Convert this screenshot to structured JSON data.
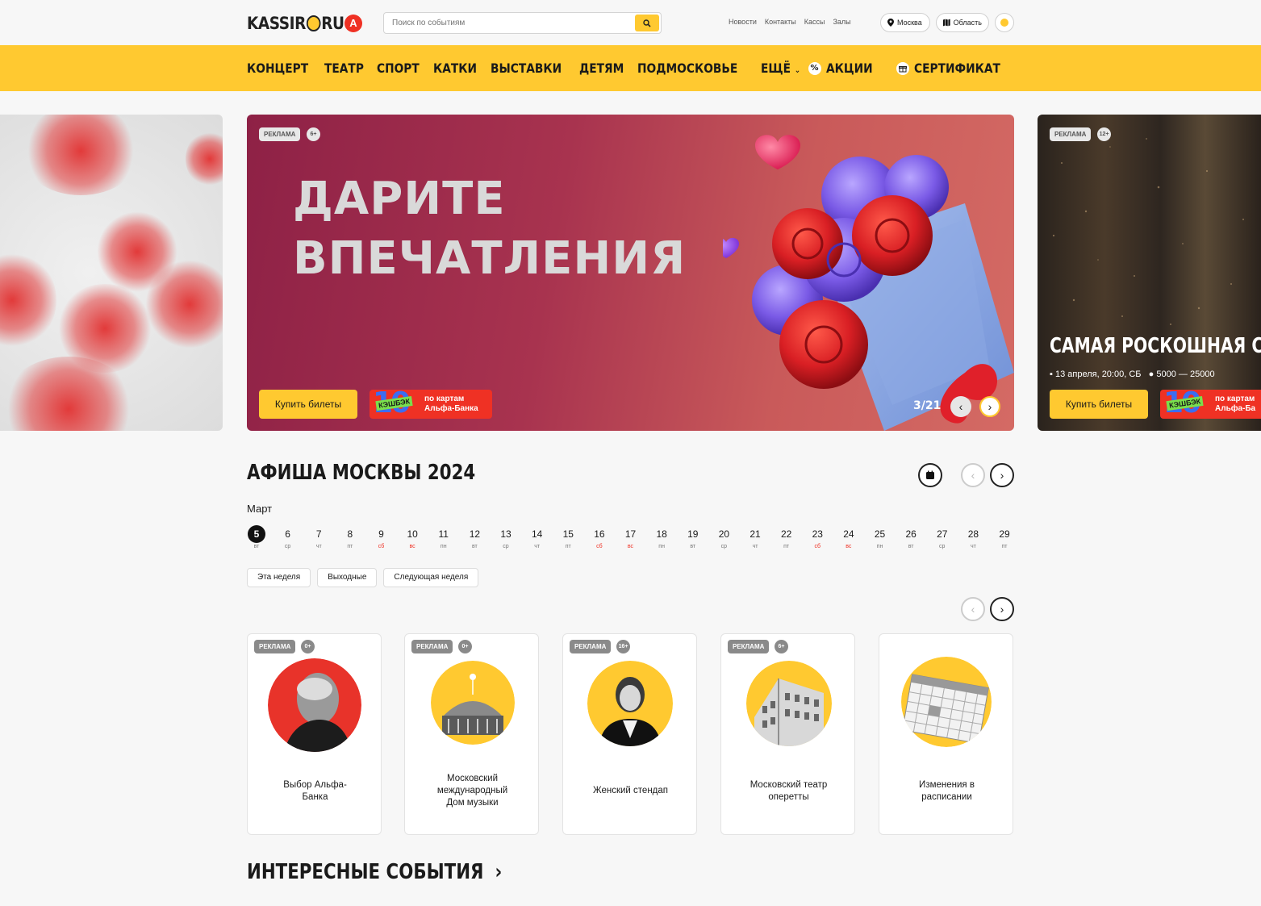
{
  "header": {
    "logo_text": "KASSIR",
    "logo_suffix": "RU",
    "logo_badge": "А",
    "search_placeholder": "Поиск по событиям",
    "links": [
      "Новости",
      "Контакты",
      "Кассы",
      "Залы"
    ],
    "city": "Москва",
    "region": "Область"
  },
  "nav": {
    "items": [
      "КОНЦЕРТ",
      "ТЕАТР",
      "СПОРТ",
      "КАТКИ",
      "ВЫСТАВКИ",
      "ДЕТЯМ",
      "ПОДМОСКОВЬЕ",
      "ЕЩЁ"
    ],
    "promo": "АКЦИИ",
    "certificate": "СЕРТИФИКАТ"
  },
  "banner_main": {
    "ad_label": "РЕКЛАМА",
    "age": "6+",
    "headline_line1": "ДАРИТЕ",
    "headline_line2": "ВПЕЧАТЛЕНИЯ",
    "buy_label": "Купить билеты",
    "cashback_percent": "10",
    "cashback_label": "КЭШБЭК",
    "cashback_text_line1": "по картам",
    "cashback_text_line2": "Альфа-Банка",
    "counter": "3/21"
  },
  "banner_right": {
    "ad_label": "РЕКЛАМА",
    "age": "12+",
    "title": "САМАЯ РОСКОШНАЯ СВА",
    "date": "13 апреля, 20:00, СБ",
    "price": "5000 — 25000",
    "buy_label": "Купить билеты",
    "cashback_percent": "10",
    "cashback_label": "КЭШБЭК",
    "cashback_text_line1": "по картам",
    "cashback_text_line2": "Альфа-Бa"
  },
  "afisha": {
    "title": "АФИША МОСКВЫ 2024",
    "month": "Март",
    "days": [
      {
        "num": "5",
        "wd": "вт",
        "active": true
      },
      {
        "num": "6",
        "wd": "ср"
      },
      {
        "num": "7",
        "wd": "чт"
      },
      {
        "num": "8",
        "wd": "пт"
      },
      {
        "num": "9",
        "wd": "сб",
        "weekend": true
      },
      {
        "num": "10",
        "wd": "вс",
        "weekend": true
      },
      {
        "num": "11",
        "wd": "пн"
      },
      {
        "num": "12",
        "wd": "вт"
      },
      {
        "num": "13",
        "wd": "ср"
      },
      {
        "num": "14",
        "wd": "чт"
      },
      {
        "num": "15",
        "wd": "пт"
      },
      {
        "num": "16",
        "wd": "сб",
        "weekend": true
      },
      {
        "num": "17",
        "wd": "вс",
        "weekend": true
      },
      {
        "num": "18",
        "wd": "пн"
      },
      {
        "num": "19",
        "wd": "вт"
      },
      {
        "num": "20",
        "wd": "ср"
      },
      {
        "num": "21",
        "wd": "чт"
      },
      {
        "num": "22",
        "wd": "пт"
      },
      {
        "num": "23",
        "wd": "сб",
        "weekend": true
      },
      {
        "num": "24",
        "wd": "вс",
        "weekend": true
      },
      {
        "num": "25",
        "wd": "пн"
      },
      {
        "num": "26",
        "wd": "вт"
      },
      {
        "num": "27",
        "wd": "ср"
      },
      {
        "num": "28",
        "wd": "чт"
      },
      {
        "num": "29",
        "wd": "пт"
      }
    ],
    "chips": [
      "Эта неделя",
      "Выходные",
      "Следующая неделя"
    ]
  },
  "cards": [
    {
      "ad": "РЕКЛАМА",
      "age": "0+",
      "label_line1": "Выбор Альфа-",
      "label_line2": "Банка",
      "label_line3": "",
      "color": "#e8332a"
    },
    {
      "ad": "РЕКЛАМА",
      "age": "0+",
      "label_line1": "Московский",
      "label_line2": "международный",
      "label_line3": "Дом музыки",
      "color": "#ffc930"
    },
    {
      "ad": "РЕКЛАМА",
      "age": "16+",
      "label_line1": "Женский стендап",
      "label_line2": "",
      "label_line3": "",
      "color": "#ffc930"
    },
    {
      "ad": "РЕКЛАМА",
      "age": "6+",
      "label_line1": "Московский театр",
      "label_line2": "оперетты",
      "label_line3": "",
      "color": "#ffc930"
    },
    {
      "ad": "",
      "age": "",
      "label_line1": "Изменения в",
      "label_line2": "расписании",
      "label_line3": "",
      "color": "#ffc930"
    }
  ],
  "interesting": {
    "title": "ИНТЕРЕСНЫЕ СОБЫТИЯ"
  },
  "colors": {
    "accent": "#ffc930",
    "alfa_red": "#ef3124",
    "weekend": "#ef3124"
  }
}
